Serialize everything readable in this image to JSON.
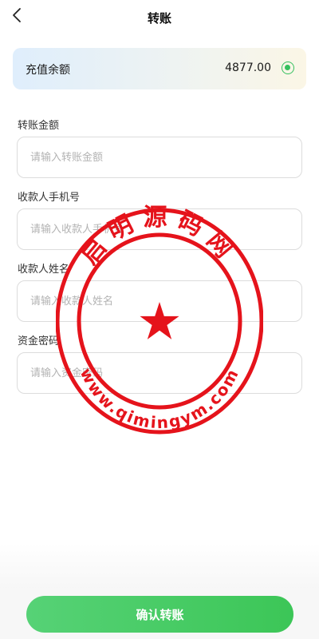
{
  "header": {
    "title": "转账",
    "back_icon": "chevron-left-icon"
  },
  "balance": {
    "label": "充值余额",
    "value": "4877.00",
    "selected": true,
    "accent": "#36c05f"
  },
  "form": {
    "amount": {
      "label": "转账金额",
      "placeholder": "请输入转账金额",
      "value": ""
    },
    "phone": {
      "label": "收款人手机号",
      "placeholder": "请输入收款人手机号",
      "value": ""
    },
    "name": {
      "label": "收款人姓名",
      "placeholder": "请输入收款人姓名",
      "value": ""
    },
    "password": {
      "label": "资金密码",
      "placeholder": "请输入资金密码",
      "value": ""
    }
  },
  "confirm": {
    "label": "确认转账",
    "color": "#4ccb66"
  },
  "watermark": {
    "top_text": "启明源码网",
    "bottom_text": "www.qimingym.com",
    "color": "#e5131b"
  }
}
